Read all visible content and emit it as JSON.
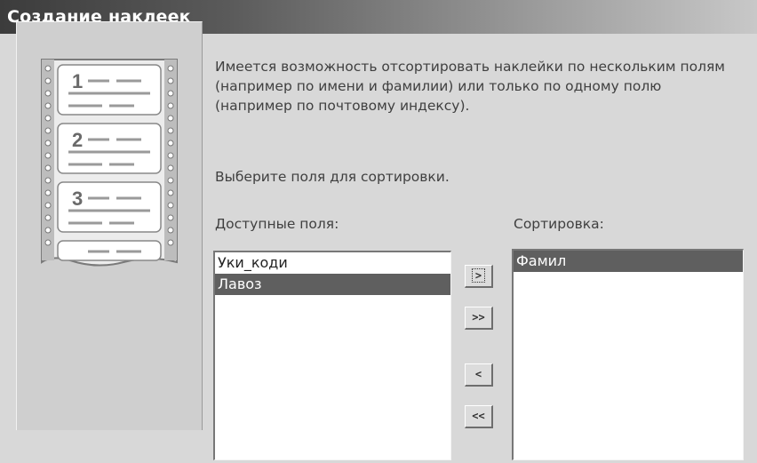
{
  "window": {
    "title": "Создание наклеек"
  },
  "illustration": {
    "icon": "labels-film-strip-icon",
    "numbers": [
      "1",
      "2",
      "3"
    ]
  },
  "description": "Имеется возможность отсортировать наклейки по нескольким полям (например по имени и фамилии) или только по одному полю (например по почтовому индексу).",
  "prompt": "Выберите поля для сортировки.",
  "available": {
    "label": "Доступные поля:",
    "items": [
      "Уки_коди",
      "Лавоз"
    ],
    "selected_index": 1
  },
  "sorting": {
    "label": "Сортировка:",
    "items": [
      "Фамил"
    ],
    "selected_index": 0
  },
  "buttons": {
    "add": ">",
    "add_all": ">>",
    "remove": "<",
    "remove_all": "<<"
  }
}
